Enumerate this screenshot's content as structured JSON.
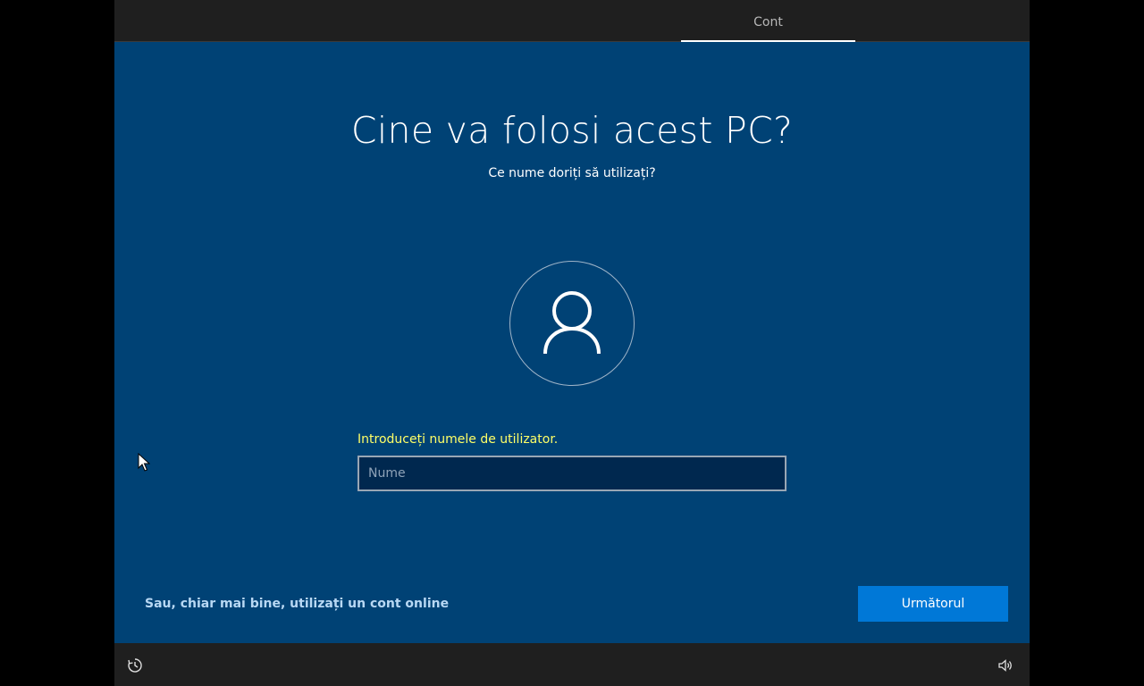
{
  "header": {
    "tab_label": "Cont"
  },
  "main": {
    "title": "Cine va folosi acest PC?",
    "subtitle": "Ce nume doriți să utilizați?",
    "avatar_icon": "user-icon",
    "input_prompt": "Introduceți numele de utilizator.",
    "name_input": {
      "value": "",
      "placeholder": "Nume"
    }
  },
  "footer": {
    "online_account_link": "Sau, chiar mai bine, utilizați un cont online",
    "next_button": "Următorul"
  },
  "bottom_bar": {
    "left_icon": "ease-of-access-icon",
    "right_icon": "volume-icon"
  },
  "colors": {
    "background": "#004275",
    "accent": "#0078d7",
    "prompt": "#ffff66",
    "bar": "#1f1f1f"
  }
}
